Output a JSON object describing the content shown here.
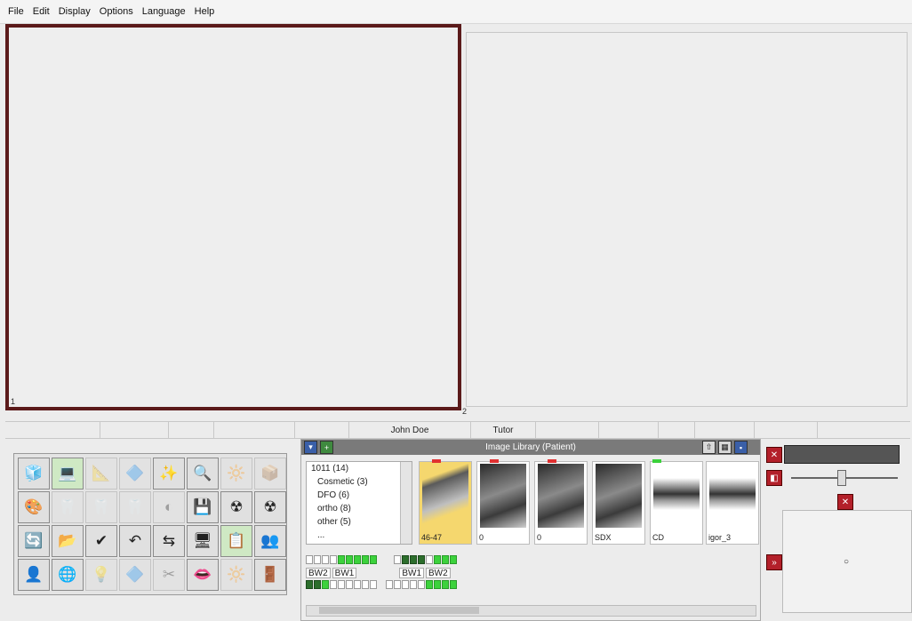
{
  "menu": [
    "File",
    "Edit",
    "Display",
    "Options",
    "Language",
    "Help"
  ],
  "viewers": {
    "left_number": "1",
    "right_number": "2"
  },
  "status": {
    "patient": "John Doe",
    "doctor": "Tutor"
  },
  "library": {
    "title": "Image Library (Patient)",
    "folders": [
      "1011 (14)",
      "Cosmetic (3)",
      "DFO (6)",
      "ortho (8)",
      "other (5)",
      "..."
    ],
    "thumbnails": [
      {
        "caption": "46-47",
        "flag": "#e03030"
      },
      {
        "caption": "0",
        "flag": "#e03030"
      },
      {
        "caption": "0",
        "flag": "#e03030"
      },
      {
        "caption": "SDX",
        "flag": ""
      },
      {
        "caption": "CD",
        "flag": "#3cd23c"
      },
      {
        "caption": "igor_3",
        "flag": ""
      }
    ],
    "bite_labels": [
      "BW2",
      "BW1",
      "BW1",
      "BW2"
    ]
  },
  "tools": [
    {
      "icon": "🧊",
      "name": "3d-view-icon",
      "state": "normal"
    },
    {
      "icon": "💻",
      "name": "acquire-icon",
      "state": "active"
    },
    {
      "icon": "📐",
      "name": "measure-icon",
      "state": "disabled"
    },
    {
      "icon": "🔷",
      "name": "shape-icon",
      "state": "disabled"
    },
    {
      "icon": "✨",
      "name": "enhance-icon",
      "state": "normal"
    },
    {
      "icon": "🔍",
      "name": "zoom-icon",
      "state": "normal"
    },
    {
      "icon": "🔆",
      "name": "brightness-icon",
      "state": "disabled"
    },
    {
      "icon": "📦",
      "name": "box-icon",
      "state": "disabled"
    },
    {
      "icon": "🎨",
      "name": "color-icon",
      "state": "normal"
    },
    {
      "icon": "🦷",
      "name": "tooth-icon",
      "state": "disabled"
    },
    {
      "icon": "🦷",
      "name": "tooth-2-icon",
      "state": "disabled"
    },
    {
      "icon": "🦷",
      "name": "tooth-3-icon",
      "state": "disabled"
    },
    {
      "icon": "◐",
      "name": "invert-icon",
      "state": "disabled"
    },
    {
      "icon": "💾",
      "name": "save-icon",
      "state": "normal"
    },
    {
      "icon": "☢",
      "name": "xray-icon",
      "state": "normal"
    },
    {
      "icon": "☢",
      "name": "xray-2-icon",
      "state": "normal"
    },
    {
      "icon": "🔄",
      "name": "rotate-icon",
      "state": "normal"
    },
    {
      "icon": "📂",
      "name": "open-icon",
      "state": "normal"
    },
    {
      "icon": "✔",
      "name": "check-icon",
      "state": "normal"
    },
    {
      "icon": "↶",
      "name": "undo-icon",
      "state": "normal"
    },
    {
      "icon": "⇆",
      "name": "flip-icon",
      "state": "normal"
    },
    {
      "icon": "🖥",
      "name": "monitor-icon",
      "state": "normal"
    },
    {
      "icon": "📋",
      "name": "clipboard-icon",
      "state": "active"
    },
    {
      "icon": "👥",
      "name": "users-icon",
      "state": "normal"
    },
    {
      "icon": "👤",
      "name": "user-icon",
      "state": "normal"
    },
    {
      "icon": "🌐",
      "name": "network-icon",
      "state": "normal"
    },
    {
      "icon": "💡",
      "name": "light-icon",
      "state": "disabled"
    },
    {
      "icon": "🔷",
      "name": "shape-2-icon",
      "state": "disabled"
    },
    {
      "icon": "✂",
      "name": "cut-icon",
      "state": "disabled"
    },
    {
      "icon": "👄",
      "name": "mouth-icon",
      "state": "normal"
    },
    {
      "icon": "🔆",
      "name": "brightness-2-icon",
      "state": "disabled"
    },
    {
      "icon": "🚪",
      "name": "exit-icon",
      "state": "normal"
    }
  ],
  "colors": {
    "viewer_border": "#5b1a1a",
    "accent_red": "#b3202a",
    "status_green": "#3cd23c"
  }
}
